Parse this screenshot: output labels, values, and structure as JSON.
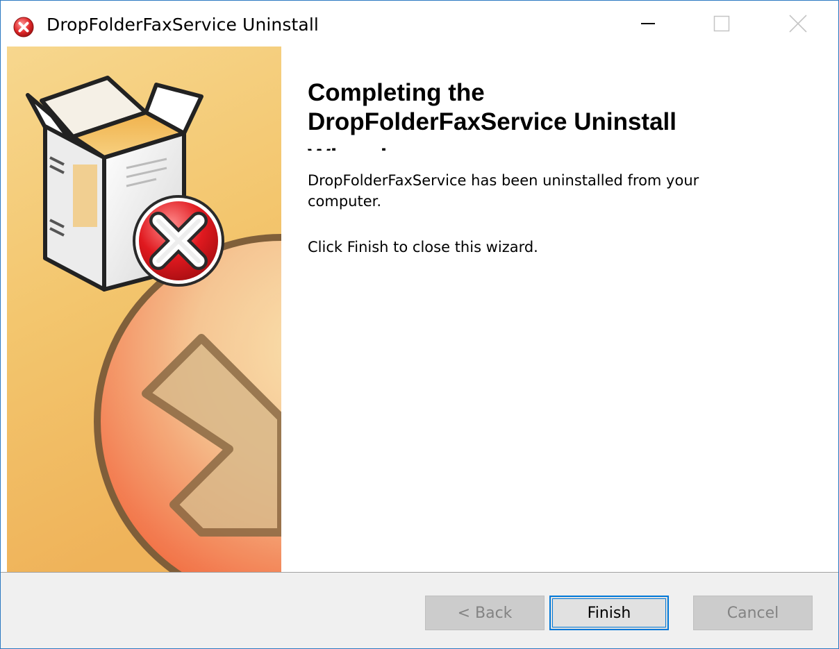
{
  "window": {
    "title": "DropFolderFaxService Uninstall",
    "app_icon": "uninstall-red-x-icon",
    "controls": {
      "minimize": "minimize-icon",
      "maximize": "maximize-icon",
      "close": "close-icon"
    },
    "accent": "#2b79c2"
  },
  "banner": {
    "icons": [
      "software-box-icon",
      "red-x-badge-icon",
      "large-x-circle-icon"
    ],
    "colors": {
      "top": "#f5d58a",
      "bottom": "#f08a50",
      "badge": "#e02020"
    }
  },
  "content": {
    "heading_line1": "Completing the",
    "heading_line2": "DropFolderFaxService Uninstall",
    "heading_line3": "Wizard",
    "message": "DropFolderFaxService has been uninstalled from your computer.",
    "instruction": "Click Finish to close this wizard."
  },
  "footer": {
    "back_label": "< Back",
    "finish_label": "Finish",
    "cancel_label": "Cancel",
    "focus_color": "#0078d7"
  }
}
